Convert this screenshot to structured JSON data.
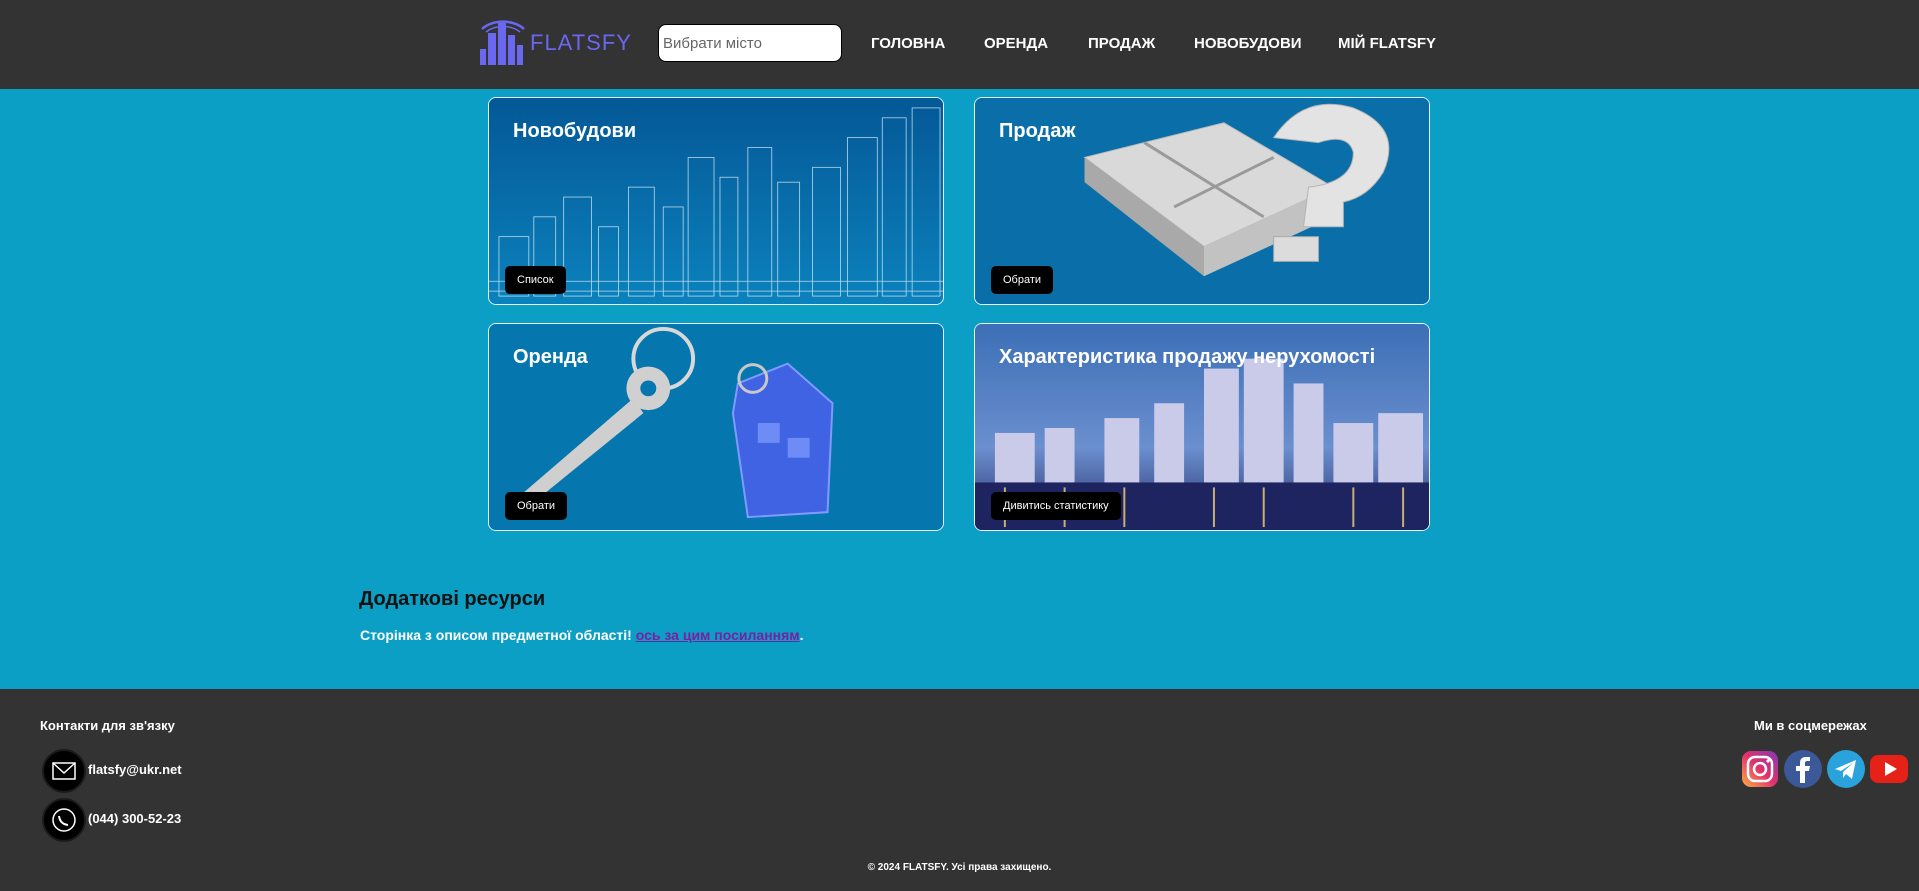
{
  "header": {
    "logo_text": "FLATSFY",
    "search_placeholder": "Вибрати місто",
    "nav": [
      "ГОЛОВНА",
      "ОРЕНДА",
      "ПРОДАЖ",
      "НОВОБУДОВИ",
      "МІЙ FLATSFY"
    ]
  },
  "cards": [
    {
      "title": "Новобудови",
      "button": "Список"
    },
    {
      "title": "Продаж",
      "button": "Обрати"
    },
    {
      "title": "Оренда",
      "button": "Обрати"
    },
    {
      "title": "Характеристика продажу нерухомості",
      "button": "Дивитись статистику"
    }
  ],
  "resources": {
    "title": "Додаткові ресурси",
    "text": "Сторінка з описом предметної області! ",
    "link": "ось за цим посиланням",
    "suffix": "."
  },
  "footer": {
    "contacts_title": "Контакти для зв'язку",
    "email": "flatsfy@ukr.net",
    "phone": "(044) 300-52-23",
    "social_title": "Ми в соцмережах",
    "copyright": "© 2024 FLATSFY. Усі права захищено."
  },
  "colors": {
    "header_bg": "#333333",
    "page_bg": "#0c9fc6",
    "logo": "#6a67f0"
  }
}
